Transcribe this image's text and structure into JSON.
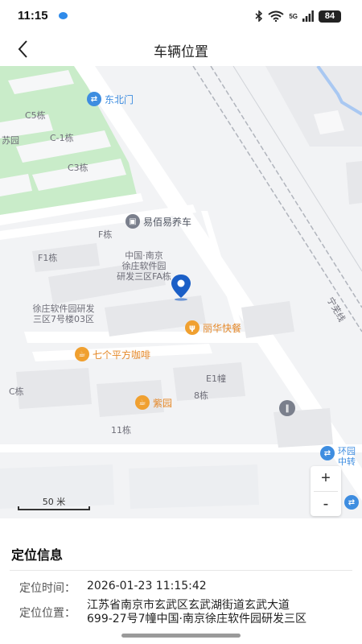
{
  "status_bar": {
    "time": "11:15",
    "network": "5G",
    "battery": "84"
  },
  "header": {
    "title": "车辆位置"
  },
  "map": {
    "labels": {
      "dongbeimen": "东北门",
      "c5": "C5栋",
      "c1": "C-1栋",
      "c3": "C3栋",
      "suyuan": "苏园",
      "yibai": "易佰易养车",
      "f": "F栋",
      "f1": "F1栋",
      "zhongguo_1": "中国·南京",
      "zhongguo_2": "徐庄软件园",
      "zhongguo_3": "研发三区FA栋",
      "xuzhuang_1": "徐庄软件园研发",
      "xuzhuang_2": "三区7号楼03区",
      "lihua": "丽华快餐",
      "qige": "七个平方咖啡",
      "e1": "E1幢",
      "b8": "8栋",
      "c": "C栋",
      "ziyuan": "紫园",
      "b11": "11栋",
      "huanyuan_1": "环园",
      "huanyuan_2": "中转",
      "rail": "宁芜线"
    },
    "icons": {
      "vertical_pin": "location-pin-icon"
    },
    "colors": {
      "green_area": "#c9ecc9",
      "rail": "#b0b4bc",
      "pin": "#1b5fc7",
      "water": "#a9c8f2"
    },
    "scale": "50 米",
    "zoom_in": "+",
    "zoom_out": "-"
  },
  "info": {
    "title": "定位信息",
    "time_label": "定位时间：",
    "time_value": "2026-01-23 11:15:42",
    "location_label": "定位位置：",
    "location_value_1": "江苏省南京市玄武区玄武湖街道玄武大道",
    "location_value_2": "699-27号7幢中国·南京徐庄软件园研发三区"
  }
}
